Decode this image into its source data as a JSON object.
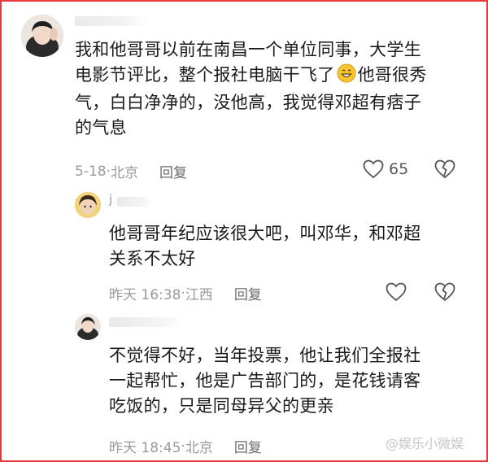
{
  "comments": [
    {
      "text_before_emoji": "我和他哥哥以前在南昌一个单位同事，大学生\n电影节评比，整个报社电脑干飞了",
      "emoji": "smile-emoji",
      "text_after_emoji": "他哥很秀\n气，白白净净的，没他高，我觉得邓超有痞子\n的气息",
      "date": "5-18",
      "location": "北京",
      "reply_label": "回复",
      "like_count": "65"
    },
    {
      "username_initial": "j",
      "text": "他哥哥年纪应该很大吧，叫邓华，和邓超\n关系不太好",
      "date": "昨天 16:38",
      "location": "江西",
      "reply_label": "回复"
    },
    {
      "text": "不觉得不好，当年投票，他让我们全报社\n一起帮忙，他是广告部门的，是花钱请客\n吃饭的，只是同母异父的更亲",
      "date": "昨天 18:45",
      "location": "北京",
      "reply_label": "回复"
    }
  ],
  "watermark": "@娱乐小微娱",
  "colors": {
    "frame": "#e63a3a",
    "meta": "#9a9a9a",
    "text": "#1a1a1a"
  }
}
